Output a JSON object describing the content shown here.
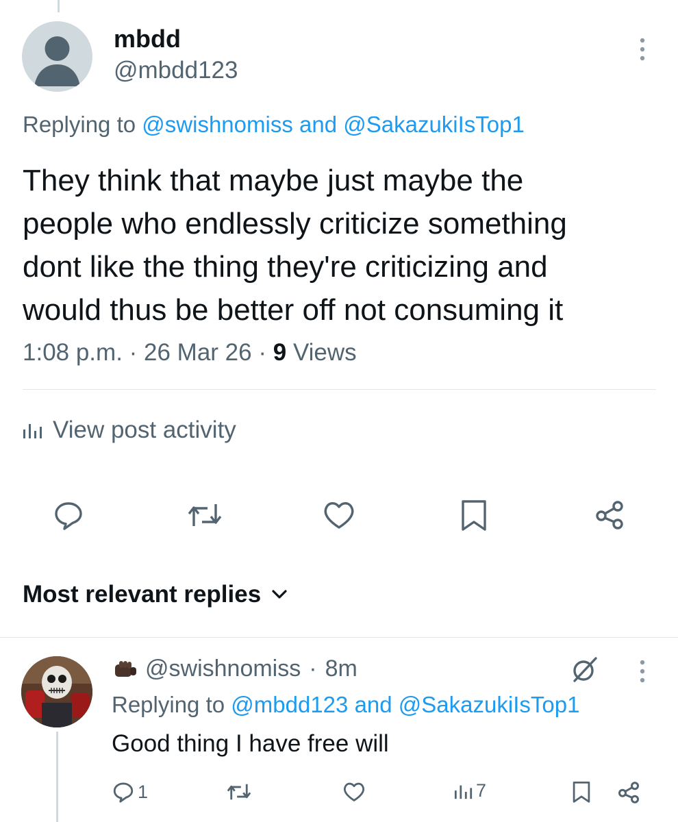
{
  "post": {
    "display_name": "mbdd",
    "handle": "@mbdd123",
    "replying_prefix": "Replying to",
    "replying_to_1": "@swishnomiss",
    "replying_and": "and",
    "replying_to_2": "@SakazukiIsTop1",
    "text_lines": [
      "They think that maybe just maybe the",
      "people who endlessly criticize something",
      "dont like the thing they're criticizing and",
      "would thus be better off not consuming it"
    ],
    "time": "1:08 p.m.",
    "date": "26 Mar 26",
    "views_count": "9",
    "views_label": "Views",
    "activity_label": "View post activity"
  },
  "replies_section": {
    "sort_label": "Most relevant replies"
  },
  "reply": {
    "handle": "@swishnomiss",
    "age": "8m",
    "replying_prefix": "Replying to",
    "replying_to_1": "@mbdd123",
    "replying_and": "and",
    "replying_to_2": "@SakazukiIsTop1",
    "text": "Good thing I have free will",
    "reply_count": "1",
    "views_count": "7"
  },
  "colors": {
    "link": "#1d9bf0",
    "secondary_text": "#536471",
    "primary_text": "#0f1419"
  }
}
